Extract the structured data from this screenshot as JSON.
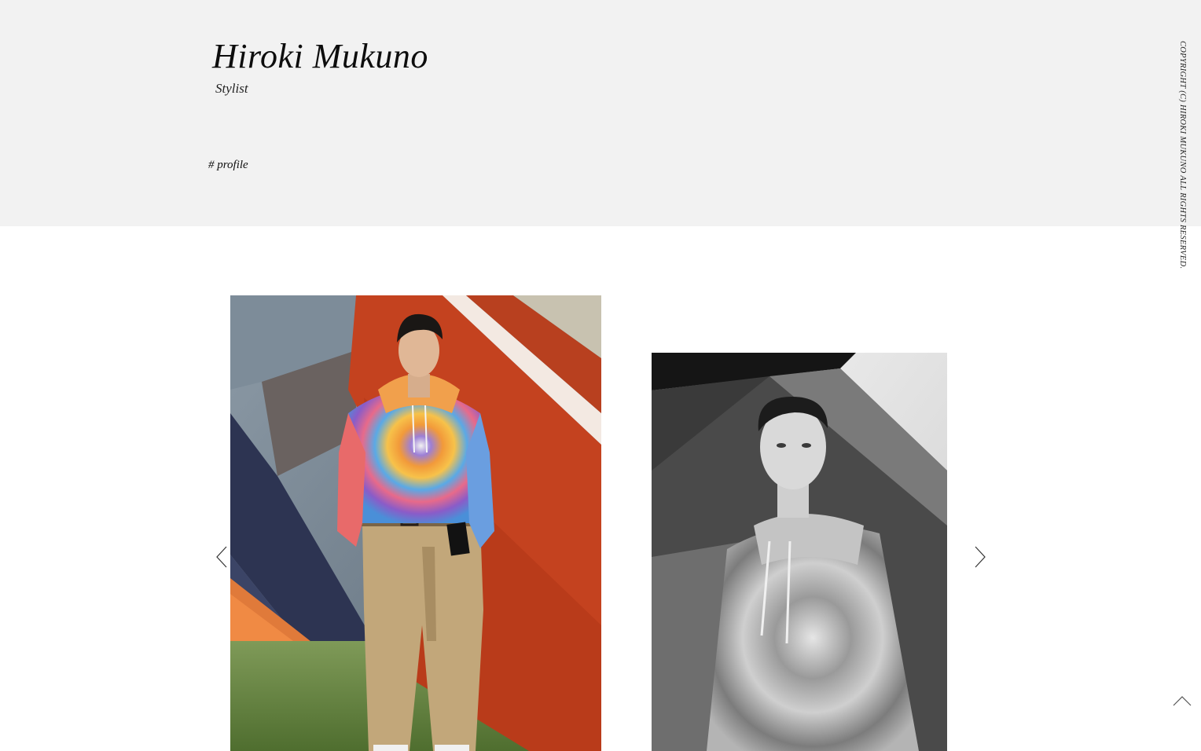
{
  "header": {
    "title": "Hiroki Mukuno",
    "subtitle": "Stylist",
    "nav": [
      {
        "label": "# profile"
      }
    ]
  },
  "copyright": "COPYRIGHT (C) HIROKI MUKUNO ALL RIGHTS RESERVED.",
  "carousel": {
    "slides": [
      {
        "description_icon": "model-tie-dye-hoodie-color-photo"
      },
      {
        "description_icon": "model-tie-dye-hoodie-bw-photo"
      }
    ],
    "prev_icon": "chevron-left-icon",
    "next_icon": "chevron-right-icon"
  },
  "back_to_top_icon": "chevron-up-icon",
  "colors": {
    "header_background": "#f2f2f2",
    "page_background": "#ffffff",
    "text": "#111111"
  }
}
